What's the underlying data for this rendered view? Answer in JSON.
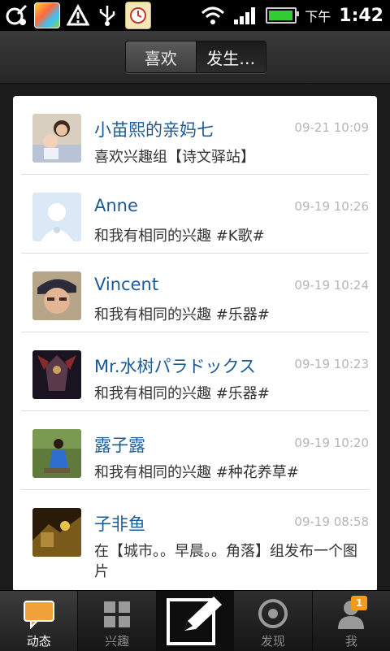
{
  "status_bar": {
    "ampm": "下午",
    "time": "1:42",
    "icons": [
      "notification-icon",
      "game-app-icon",
      "warning-icon",
      "usb-icon",
      "clock-app-icon",
      "wifi-icon",
      "signal-icon",
      "battery-icon"
    ],
    "battery_level": 0.85
  },
  "header": {
    "tabs": [
      {
        "label": "喜欢",
        "active": false
      },
      {
        "label": "发生…",
        "active": true
      }
    ]
  },
  "feed": [
    {
      "name": "小苗熙的亲妈七",
      "time": "09-21 10:09",
      "text": "喜欢兴趣组【诗文驿站】",
      "avatar": "photo-baby"
    },
    {
      "name": "Anne",
      "time": "09-19 10:26",
      "text": "和我有相同的兴趣 #K歌#",
      "avatar": "default-avatar"
    },
    {
      "name": "Vincent",
      "time": "09-19 10:24",
      "text": "和我有相同的兴趣 #乐器#",
      "avatar": "photo-person"
    },
    {
      "name": "Mr.水树パラドックス",
      "time": "09-19 10:23",
      "text": "和我有相同的兴趣 #乐器#",
      "avatar": "photo-armor"
    },
    {
      "name": "露子露",
      "time": "09-19 10:20",
      "text": "和我有相同的兴趣 #种花养草#",
      "avatar": "photo-woman"
    },
    {
      "name": "子非鱼",
      "time": "09-19 08:58",
      "text": "在【城市。。早晨。。角落】组发布一个图片",
      "avatar": "photo-city"
    }
  ],
  "bottom_nav": {
    "items": [
      {
        "label": "动态",
        "icon": "chat-bubble-icon",
        "active": true
      },
      {
        "label": "兴趣",
        "icon": "grid-icon",
        "active": false
      },
      {
        "label": "",
        "icon": "compose-icon",
        "active": false
      },
      {
        "label": "发现",
        "icon": "target-icon",
        "active": false
      },
      {
        "label": "我",
        "icon": "person-icon",
        "active": false,
        "badge": "1"
      }
    ]
  },
  "colors": {
    "name_blue": "#1a5a97",
    "time_gray": "#b5b5b5",
    "badge_orange": "#f39a1a"
  }
}
